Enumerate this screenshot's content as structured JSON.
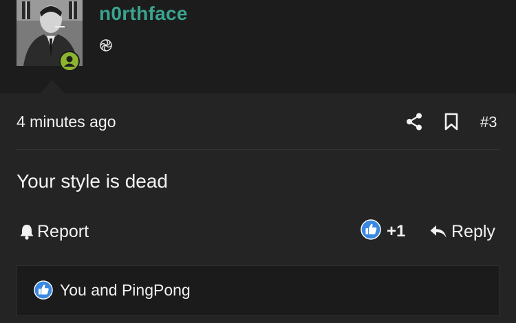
{
  "user": {
    "username": "n0rthface",
    "online": true
  },
  "post": {
    "timestamp": "4 minutes ago",
    "number": "#3",
    "body": "Your style is dead",
    "report_label": "Report",
    "like_count": "+1",
    "reply_label": "Reply",
    "reactions_text": "You and PingPong"
  },
  "colors": {
    "username": "#3aa48f",
    "online_badge": "#8cb42f",
    "like": "#3b88e0"
  },
  "icons": [
    "role-icon",
    "share-icon",
    "bookmark-icon",
    "bell-icon",
    "thumbs-up-icon",
    "reply-arrow-icon"
  ]
}
